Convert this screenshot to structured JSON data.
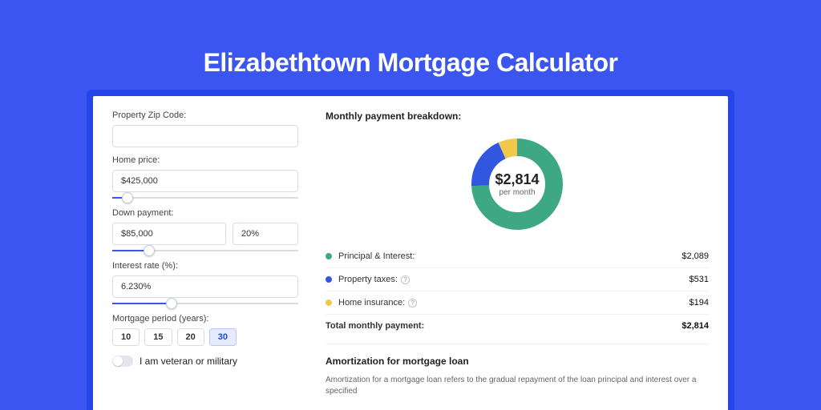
{
  "page_title": "Elizabethtown Mortgage Calculator",
  "colors": {
    "accent": "#3b56f0",
    "green": "#3ea783",
    "blue": "#3157e0",
    "yellow": "#f0c94a"
  },
  "form": {
    "zip_label": "Property Zip Code:",
    "zip_value": "",
    "home_price_label": "Home price:",
    "home_price_value": "$425,000",
    "home_price_slider_pct": 8,
    "down_payment_label": "Down payment:",
    "down_payment_value": "$85,000",
    "down_payment_pct_value": "20%",
    "down_payment_slider_pct": 20,
    "rate_label": "Interest rate (%):",
    "rate_value": "6.230%",
    "rate_slider_pct": 32,
    "period_label": "Mortgage period (years):",
    "periods": [
      "10",
      "15",
      "20",
      "30"
    ],
    "period_selected": "30",
    "veteran_label": "I am veteran or military",
    "veteran_on": false
  },
  "breakdown": {
    "heading": "Monthly payment breakdown:",
    "amount": "$2,814",
    "per_month": "per month",
    "items": [
      {
        "key": "Principal & Interest:",
        "value": "$2,089",
        "color": "g",
        "help": false
      },
      {
        "key": "Property taxes:",
        "value": "$531",
        "color": "b",
        "help": true
      },
      {
        "key": "Home insurance:",
        "value": "$194",
        "color": "y",
        "help": true
      }
    ],
    "total_label": "Total monthly payment:",
    "total_value": "$2,814"
  },
  "amort": {
    "heading": "Amortization for mortgage loan",
    "body": "Amortization for a mortgage loan refers to the gradual repayment of the loan principal and interest over a specified"
  },
  "chart_data": {
    "type": "pie",
    "title": "Monthly payment breakdown",
    "series": [
      {
        "name": "Principal & Interest",
        "value": 2089,
        "color": "#3ea783"
      },
      {
        "name": "Property taxes",
        "value": 531,
        "color": "#3157e0"
      },
      {
        "name": "Home insurance",
        "value": 194,
        "color": "#f0c94a"
      }
    ],
    "total": 2814,
    "unit": "USD/month"
  }
}
